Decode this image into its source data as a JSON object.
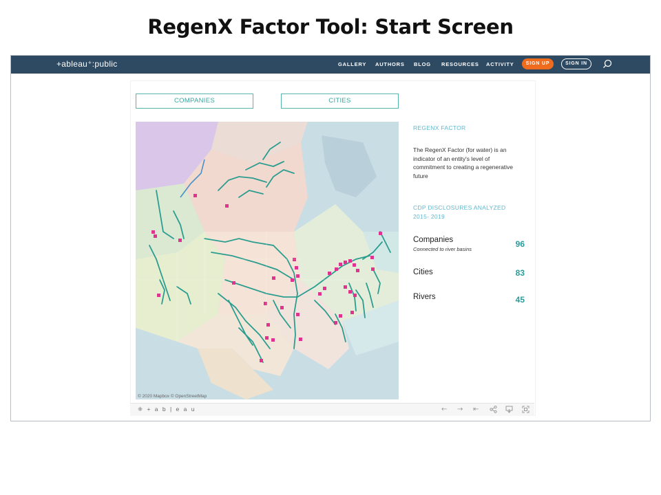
{
  "slide": {
    "title": "RegenX Factor Tool: Start Screen"
  },
  "navbar": {
    "logo": "+ableau⁺:public",
    "items": [
      "GALLERY",
      "AUTHORS",
      "BLOG",
      "RESOURCES",
      "ACTIVITY"
    ],
    "signup": "SIGN UP",
    "signin": "SIGN IN",
    "search_icon": "search-icon",
    "colors": {
      "bar": "#2e4a63",
      "signup": "#ef6c1e"
    }
  },
  "dashboard": {
    "tabs": [
      "COMPANIES",
      "CITIES"
    ],
    "map_credit": "© 2020 Mapbox © OpenStreetMap",
    "sidebar": {
      "heading1": "REGENX FACTOR",
      "description": "The RegenX Factor (for water) is an indicator of an entity's level of commitment to creating a regenerative future",
      "heading2": "CDP DISCLOSURES ANALYZED 2015- 2019",
      "stats": [
        {
          "label": "Companies",
          "sublabel": "Connected to river basins",
          "value": "96"
        },
        {
          "label": "Cities",
          "value": "83"
        },
        {
          "label": "Rivers",
          "value": "45"
        }
      ]
    },
    "colors": {
      "accent": "#3aa39c",
      "heading": "#5fb8cc",
      "river": "#2a9d8f",
      "marker": "#e0338f"
    }
  },
  "toolbar": {
    "logo": "⁜ + a b | e a u",
    "icons": [
      "undo-icon",
      "redo-icon",
      "revert-icon",
      "share-icon",
      "download-icon",
      "fullscreen-icon"
    ]
  }
}
